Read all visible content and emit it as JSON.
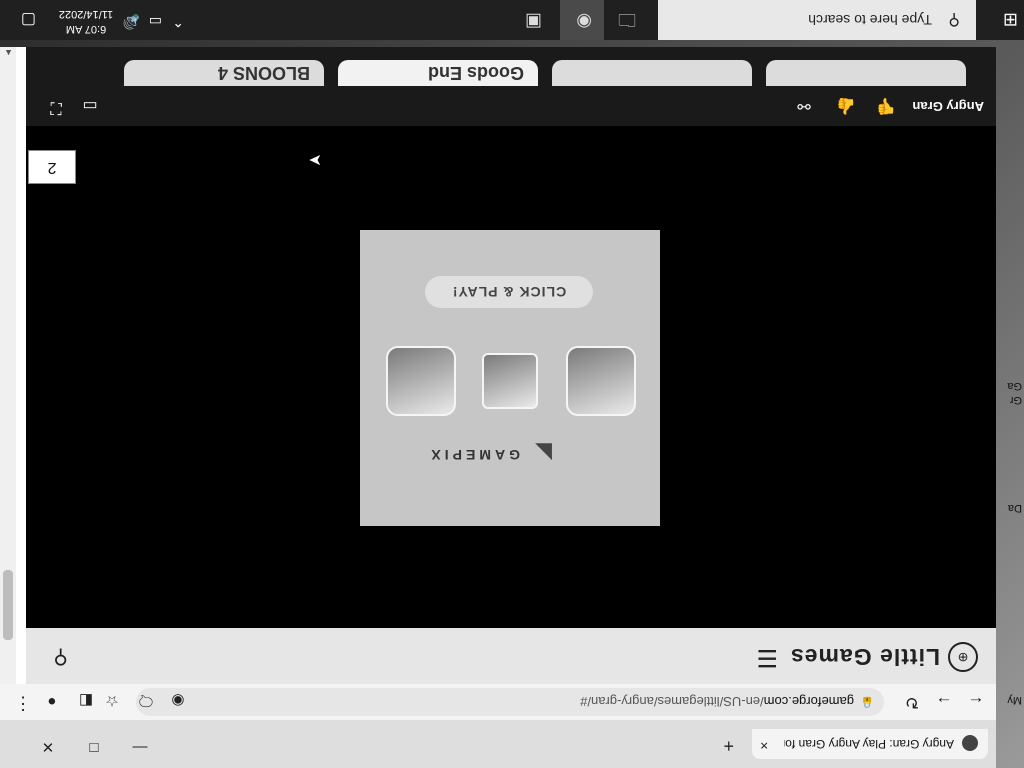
{
  "desktop": {
    "labels": [
      "My",
      "Da",
      "Gr",
      "Ga"
    ]
  },
  "browser": {
    "tab": {
      "title": "Angry Gran: Play Angry Gran for",
      "close": "×"
    },
    "newtab": "+",
    "window": {
      "minimize": "—",
      "maximize": "□",
      "close": "✕"
    },
    "toolbar": {
      "back": "←",
      "forward": "→",
      "reload": "↻",
      "lock": "🔒",
      "url_domain": "gameforge.com",
      "url_path": "/en-US/littlegames/angry-gran/#",
      "edge_icon": "◉",
      "read_aloud": "🗨",
      "favorite": "☆",
      "collections": "◧",
      "profile": "●",
      "menu": "⋮"
    }
  },
  "page": {
    "header": {
      "logo_glyph": "⊕",
      "brand": "Little Games",
      "menu": "☰",
      "search": "⚲"
    },
    "badge": "2",
    "gamecard": {
      "brand_glyph": "◣",
      "brand": "GAMEPIX",
      "cta": "CLICK & PLAY!"
    },
    "gamebar": {
      "title": "Angry Gran",
      "thumbs_down": "👎",
      "thumbs_up": "👍",
      "share": "⚯",
      "theater": "▭",
      "fullscreen": "⛶"
    },
    "related": [
      "BLOONS 4",
      "Goods End",
      "",
      ""
    ]
  },
  "taskbar": {
    "start": "⊞",
    "search_icon": "⚲",
    "search_placeholder": "Type here to search",
    "chevron": "⌃",
    "network": "▭",
    "volume": "🔊",
    "time": "6:07 AM",
    "date": "11/14/2022",
    "notifications": "▢"
  }
}
